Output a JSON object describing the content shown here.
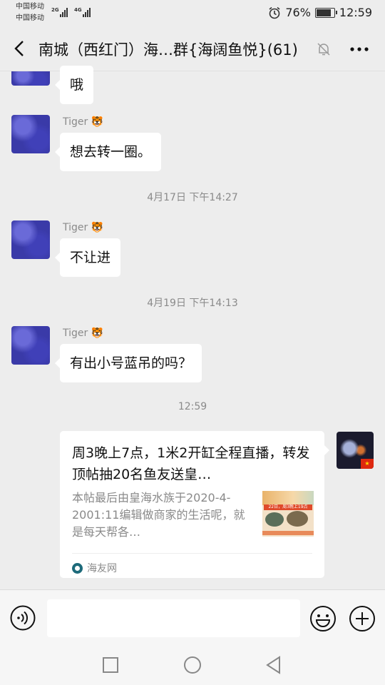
{
  "status_bar": {
    "carrier_1": "中国移动",
    "carrier_2": "中国移动",
    "network_1": "2G",
    "network_2": "4G",
    "battery": "76%",
    "battery_level": 0.76,
    "time": "12:59"
  },
  "header": {
    "title": "南城（西红门）海…群{海阔鱼悦}(61)",
    "back_icon": "chevron-left-icon",
    "mute_icon": "bell-off-icon",
    "more_icon": "ellipsis-icon"
  },
  "messages": [
    {
      "text": "哦"
    },
    {
      "sender": "Tiger",
      "sender_emoji": "🐯",
      "text": "想去转一圈。"
    },
    {
      "timestamp": "4月17日 下午14:27"
    },
    {
      "sender": "Tiger",
      "sender_emoji": "🐯",
      "text": "不让进"
    },
    {
      "timestamp": "4月19日 下午14:13"
    },
    {
      "sender": "Tiger",
      "sender_emoji": "🐯",
      "text": "有出小号蓝吊的吗？"
    },
    {
      "timestamp": "12:59"
    }
  ],
  "shared_card": {
    "title": "周3晚上7点，1米2开缸全程直播，转发顶帖抽20名鱼友送皇…",
    "description": "本帖最后由皇海水族于2020-4-2001:11编辑做商家的生活呢，就是每天帮各…",
    "thumb_caption": "22日，周3晚上19点",
    "source": "海友网"
  },
  "input_bar": {
    "placeholder": "",
    "voice_icon": "voice-icon",
    "emoji_icon": "smiley-icon",
    "add_icon": "plus-circle-icon"
  },
  "nav": {
    "recent_icon": "square-icon",
    "home_icon": "circle-icon",
    "back_icon": "triangle-back-icon"
  }
}
